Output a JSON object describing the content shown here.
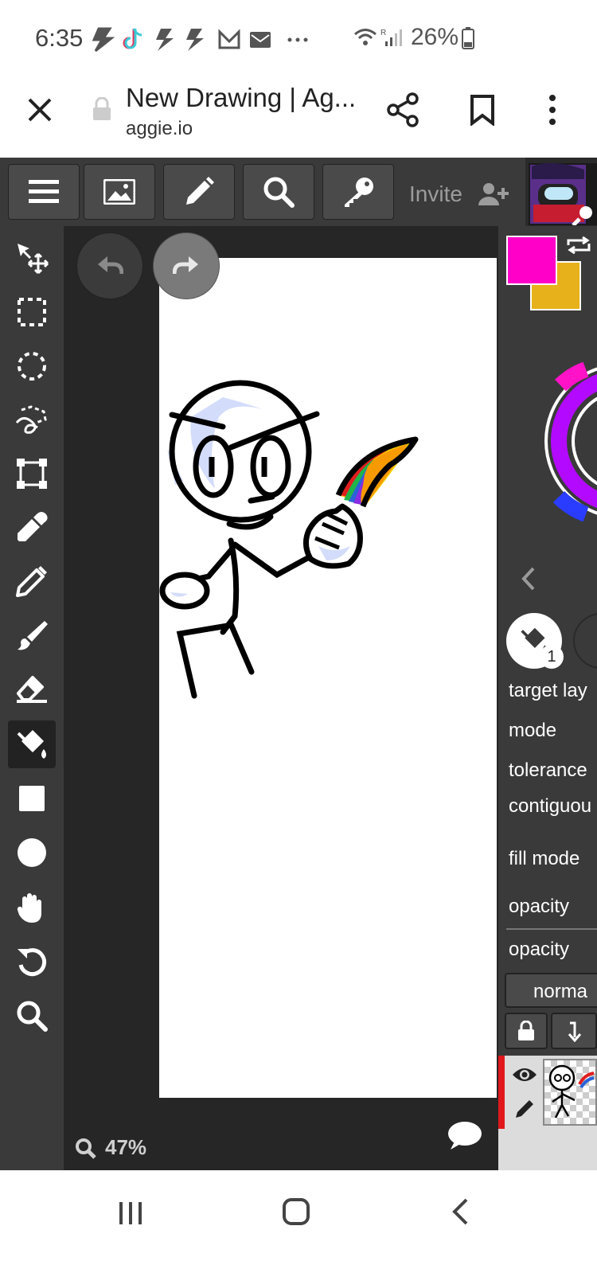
{
  "status_bar": {
    "time": "6:35",
    "notification_icons": [
      "bolt-icon",
      "tiktok-icon",
      "bolt-icon",
      "bolt-icon",
      "gmail-icon",
      "mail-icon",
      "more-icon"
    ],
    "battery": "26%"
  },
  "browser": {
    "title": "New Drawing | Ag...",
    "url": "aggie.io"
  },
  "toolbar": {
    "invite_label": "Invite"
  },
  "tools": [
    "move",
    "rect-select",
    "ellipse-select",
    "lasso",
    "transform",
    "eyedropper",
    "pencil",
    "brush",
    "eraser",
    "fill",
    "rectangle",
    "ellipse",
    "hand",
    "rotate",
    "zoom"
  ],
  "active_tool": "fill",
  "canvas": {
    "zoom_label": "47%"
  },
  "colors": {
    "primary": "#ff00c8",
    "secondary": "#e6b11a",
    "background": "#2a2a2a",
    "panel": "#3a3a3a"
  },
  "fill_panel": {
    "tool_badge": "1",
    "props": [
      "target lay",
      "mode",
      "tolerance",
      "contiguou",
      "fill mode",
      "opacity"
    ],
    "layer_opacity_label": "opacity",
    "blend_mode": "norma"
  }
}
